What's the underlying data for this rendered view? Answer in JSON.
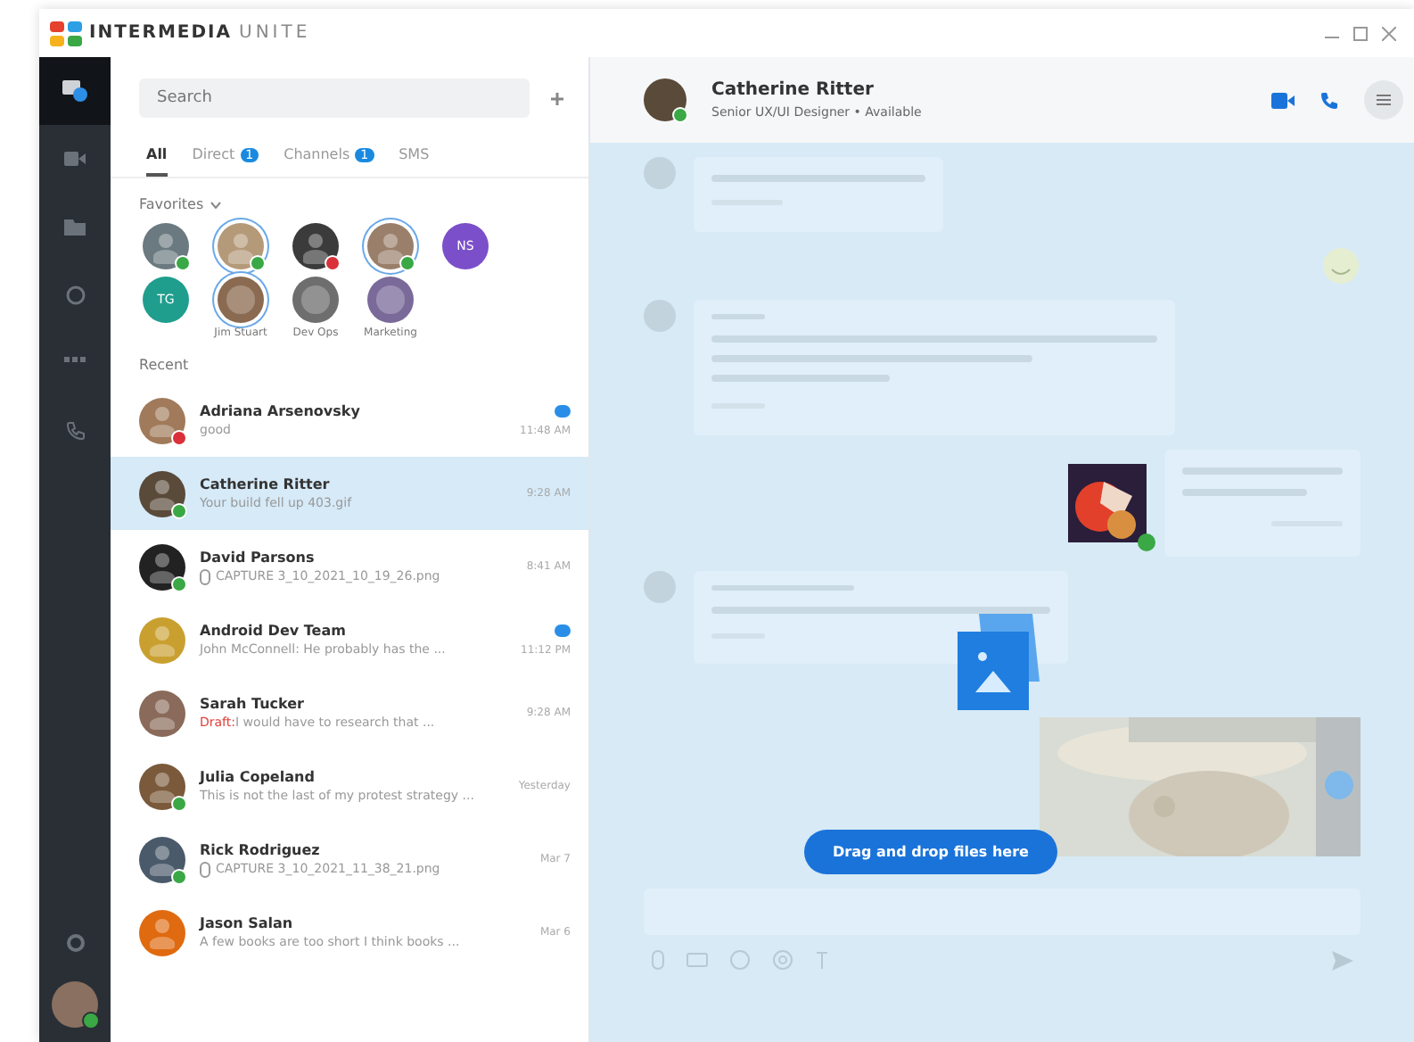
{
  "app": {
    "logo_text": "INTERMEDIA",
    "logo_suffix": "UNITE"
  },
  "rail": {
    "items": [
      {
        "selected": true
      },
      {
        "selected": false
      },
      {
        "selected": false
      },
      {
        "selected": false
      },
      {
        "selected": false
      },
      {
        "selected": false
      }
    ]
  },
  "search": {
    "placeholder": "Search"
  },
  "tabs": [
    {
      "label": "All",
      "selected": true
    },
    {
      "label": "Direct",
      "badge": "1",
      "selected": false
    },
    {
      "label": "Channels",
      "badge": "1",
      "selected": false
    },
    {
      "label": "SMS",
      "selected": false
    }
  ],
  "favorites": {
    "title": "Favorites",
    "items": [
      {
        "kind": "person",
        "color": "#6b7a80",
        "status": {
          "color": "#3aa845"
        },
        "ring": false
      },
      {
        "kind": "person",
        "color": "#b59a7a",
        "status": {
          "color": "#3aa845"
        },
        "ring": true
      },
      {
        "kind": "person",
        "color": "#3b3b3b",
        "status": {
          "color": "#d9303a"
        },
        "ring": false
      },
      {
        "kind": "person",
        "color": "#9a7f6a",
        "status": {
          "color": "#3aa845"
        },
        "ring": true
      },
      {
        "kind": "initials",
        "color": "#7b4fc9",
        "initials": "NS",
        "ring": false
      },
      {
        "kind": "initials",
        "color": "#1f9e8e",
        "initials": "TG",
        "ring": false
      },
      {
        "kind": "group",
        "color": "#8a6a50",
        "label": "Jim Stuart",
        "ring": true
      },
      {
        "kind": "group",
        "color": "#6e6e6e",
        "label": "Dev Ops",
        "ring": false
      },
      {
        "kind": "group",
        "color": "#7a6a9a",
        "label": "Marketing",
        "ring": false
      }
    ]
  },
  "recent": {
    "title": "Recent",
    "chats": [
      {
        "name": "Adriana Arsenovsky",
        "preview": "good",
        "time": "11:48 AM",
        "unread": true,
        "status": {
          "color": "#d9303a"
        },
        "color": "#a07a5a",
        "selected": false
      },
      {
        "name": "Catherine Ritter",
        "preview": "Your build fell up 403.gif",
        "time": "9:28 AM",
        "unread": false,
        "status": {
          "color": "#3aa845"
        },
        "color": "#5a4a3a",
        "selected": true
      },
      {
        "name": "David Parsons",
        "preview": "CAPTURE 3_10_2021_10_19_26.png",
        "attachment": true,
        "time": "8:41 AM",
        "unread": false,
        "status": {
          "color": "#3aa845"
        },
        "color": "#222222",
        "selected": false
      },
      {
        "name": "Android Dev Team",
        "preview": "John McConnell: He probably has the ...",
        "time": "11:12 PM",
        "unread": true,
        "color": "#c9a030",
        "selected": false
      },
      {
        "name": "Sarah Tucker",
        "draft": "Draft:",
        "preview": "I would have to research that ...",
        "time": "9:28 AM",
        "unread": false,
        "color": "#8a6a5a",
        "selected": false
      },
      {
        "name": "Julia Copeland",
        "preview": "This is not the last of my protest strategy ...",
        "time": "Yesterday",
        "unread": false,
        "status": {
          "color": "#3aa845"
        },
        "color": "#7a5a3a",
        "selected": false
      },
      {
        "name": "Rick Rodriguez",
        "preview": "CAPTURE 3_10_2021_11_38_21.png",
        "attachment": true,
        "time": "Mar 7",
        "unread": false,
        "status": {
          "color": "#3aa845"
        },
        "color": "#4a5a6a",
        "selected": false
      },
      {
        "name": "Jason Salan",
        "preview": "A few books are too short I think books ...",
        "time": "Mar 6",
        "unread": false,
        "color": "#e06a10",
        "selected": false
      }
    ]
  },
  "conversation": {
    "name": "Catherine Ritter",
    "subtitle": "Senior UX/UI Designer • Available",
    "status": {
      "color": "#3aa845"
    }
  },
  "drop": {
    "button": "Drag and drop files here"
  }
}
